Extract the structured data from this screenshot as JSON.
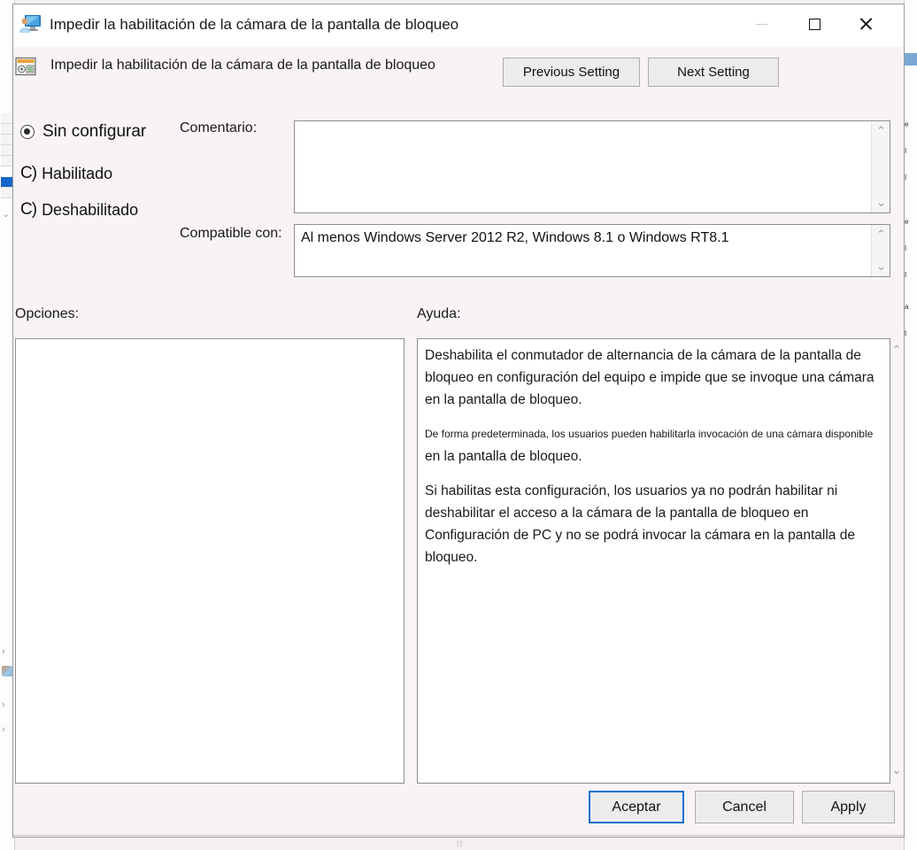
{
  "window": {
    "title": "Impedir la habilitación de la cámara de la pantalla de bloqueo",
    "title_icon": "policy-user-monitor-icon",
    "controls": {
      "minimize": "—",
      "minimize_name": "minimize",
      "maximize": "□",
      "maximize_name": "maximize",
      "close": "✕",
      "close_name": "close"
    }
  },
  "header": {
    "title": "Impedir la habilitación de la cámara de la pantalla de bloqueo",
    "icon": "group-policy-setting-icon",
    "previous_setting": "Previous Setting",
    "next_setting": "Next Setting"
  },
  "state_options": [
    {
      "id": "not-configured",
      "label": "Sin configurar",
      "selected": true,
      "glyph": ""
    },
    {
      "id": "enabled",
      "label": "Habilitado",
      "selected": false,
      "glyph": "C)"
    },
    {
      "id": "disabled",
      "label": "Deshabilitado",
      "selected": false,
      "glyph": "C)"
    }
  ],
  "fields": {
    "comment_label": "Comentario:",
    "comment_value": "",
    "supported_label": "Compatible con:",
    "supported_value": "Al menos Windows Server 2012 R2, Windows 8.1 o Windows RT8.1"
  },
  "panels": {
    "options_label": "Opciones:",
    "options_value": "",
    "help_label": "Ayuda:",
    "help_paragraphs": [
      "Deshabilita el conmutador de alternancia de la cámara de la pantalla de bloqueo en configuración del equipo e impide que se invoque una cámara en la pantalla de bloqueo.",
      "De forma predeterminada, los usuarios pueden habilitarla invocación de una cámara disponible en la pantalla de bloqueo.",
      "Si habilitas esta configuración, los usuarios ya no podrán habilitar ni deshabilitar el acceso a la cámara de la pantalla de bloqueo en Configuración de PC y no se podrá invocar la cámara en la pantalla de bloqueo."
    ]
  },
  "scrollbars": {
    "up_arrow": "⌃",
    "down_arrow": "⌄"
  },
  "footer": {
    "ok": "Aceptar",
    "cancel": "Cancel",
    "apply": "Apply"
  },
  "colors": {
    "dialog_bg": "#f7f3f6",
    "titlebar_bg": "#ffffff",
    "button_face": "#ececec",
    "button_border": "#adadad",
    "focus_blue": "#0a72d0",
    "text": "#1a1a1a",
    "selection_blue": "#1266c8"
  }
}
